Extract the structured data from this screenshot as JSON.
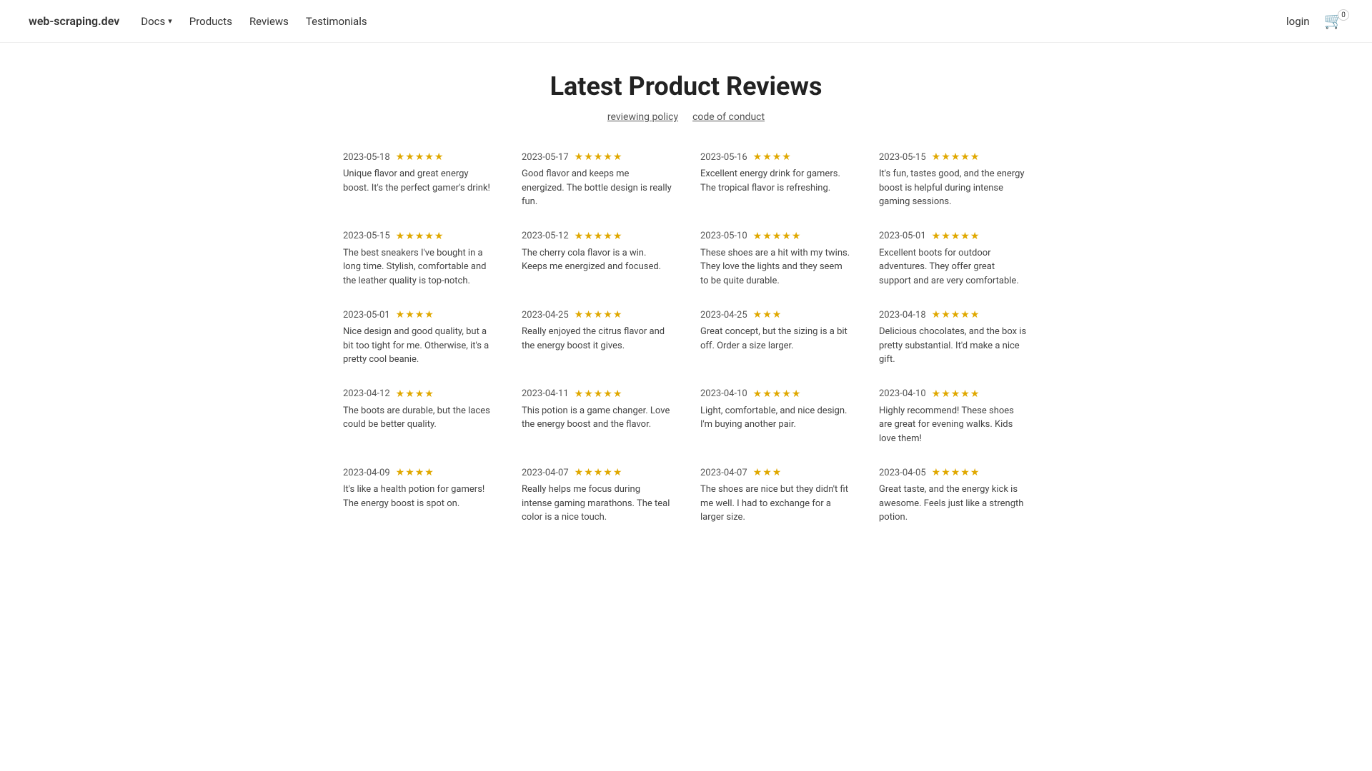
{
  "brand": "web-scraping.dev",
  "nav": {
    "docs_label": "Docs",
    "products_label": "Products",
    "reviews_label": "Reviews",
    "testimonials_label": "Testimonials",
    "login_label": "login",
    "cart_count": "0"
  },
  "page": {
    "title": "Latest Product Reviews",
    "link1_label": "reviewing policy",
    "link2_label": "code of conduct"
  },
  "reviews": [
    {
      "date": "2023-05-18",
      "stars": "★★★★★",
      "text": "Unique flavor and great energy boost. It's the perfect gamer's drink!"
    },
    {
      "date": "2023-05-17",
      "stars": "★★★★★",
      "text": "Good flavor and keeps me energized. The bottle design is really fun."
    },
    {
      "date": "2023-05-16",
      "stars": "★★★★",
      "text": "Excellent energy drink for gamers. The tropical flavor is refreshing."
    },
    {
      "date": "2023-05-15",
      "stars": "★★★★★",
      "text": "It's fun, tastes good, and the energy boost is helpful during intense gaming sessions."
    },
    {
      "date": "2023-05-15",
      "stars": "★★★★★",
      "text": "The best sneakers I've bought in a long time. Stylish, comfortable and the leather quality is top-notch."
    },
    {
      "date": "2023-05-12",
      "stars": "★★★★★",
      "text": "The cherry cola flavor is a win. Keeps me energized and focused."
    },
    {
      "date": "2023-05-10",
      "stars": "★★★★★",
      "text": "These shoes are a hit with my twins. They love the lights and they seem to be quite durable."
    },
    {
      "date": "2023-05-01",
      "stars": "★★★★★",
      "text": "Excellent boots for outdoor adventures. They offer great support and are very comfortable."
    },
    {
      "date": "2023-05-01",
      "stars": "★★★★",
      "text": "Nice design and good quality, but a bit too tight for me. Otherwise, it's a pretty cool beanie."
    },
    {
      "date": "2023-04-25",
      "stars": "★★★★★",
      "text": "Really enjoyed the citrus flavor and the energy boost it gives."
    },
    {
      "date": "2023-04-25",
      "stars": "★★★",
      "text": "Great concept, but the sizing is a bit off. Order a size larger."
    },
    {
      "date": "2023-04-18",
      "stars": "★★★★★",
      "text": "Delicious chocolates, and the box is pretty substantial. It'd make a nice gift."
    },
    {
      "date": "2023-04-12",
      "stars": "★★★★",
      "text": "The boots are durable, but the laces could be better quality."
    },
    {
      "date": "2023-04-11",
      "stars": "★★★★★",
      "text": "This potion is a game changer. Love the energy boost and the flavor."
    },
    {
      "date": "2023-04-10",
      "stars": "★★★★★",
      "text": "Light, comfortable, and nice design. I'm buying another pair."
    },
    {
      "date": "2023-04-10",
      "stars": "★★★★★",
      "text": "Highly recommend! These shoes are great for evening walks. Kids love them!"
    },
    {
      "date": "2023-04-09",
      "stars": "★★★★",
      "text": "It's like a health potion for gamers! The energy boost is spot on."
    },
    {
      "date": "2023-04-07",
      "stars": "★★★★★",
      "text": "Really helps me focus during intense gaming marathons. The teal color is a nice touch."
    },
    {
      "date": "2023-04-07",
      "stars": "★★★",
      "text": "The shoes are nice but they didn't fit me well. I had to exchange for a larger size."
    },
    {
      "date": "2023-04-05",
      "stars": "★★★★★",
      "text": "Great taste, and the energy kick is awesome. Feels just like a strength potion."
    }
  ]
}
